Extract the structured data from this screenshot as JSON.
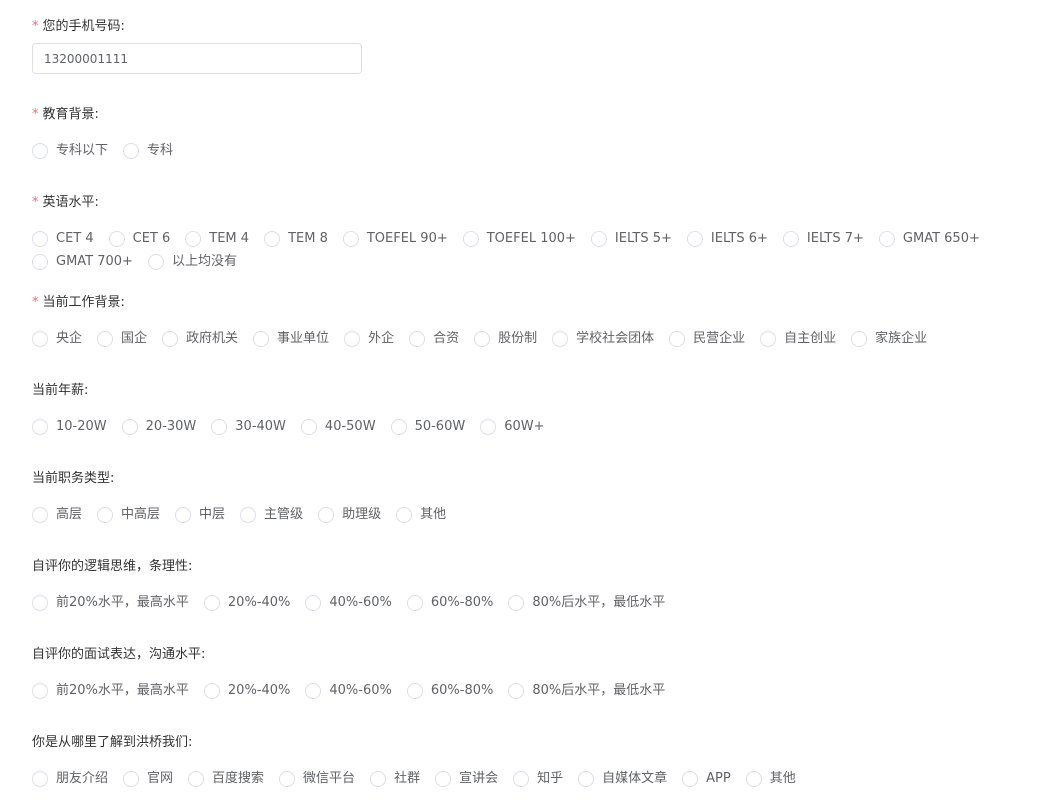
{
  "phone": {
    "label": "您的手机号码:",
    "required_mark": "*",
    "value": "13200001111"
  },
  "education": {
    "label": "教育背景:",
    "required_mark": "*",
    "options": [
      "专科以下",
      "专科"
    ]
  },
  "english": {
    "label": "英语水平:",
    "required_mark": "*",
    "options": [
      "CET 4",
      "CET 6",
      "TEM 4",
      "TEM 8",
      "TOEFEL 90+",
      "TOEFEL 100+",
      "IELTS 5+",
      "IELTS 6+",
      "IELTS 7+",
      "GMAT 650+",
      "GMAT 700+",
      "以上均没有"
    ]
  },
  "work": {
    "label": "当前工作背景:",
    "required_mark": "*",
    "options": [
      "央企",
      "国企",
      "政府机关",
      "事业单位",
      "外企",
      "合资",
      "股份制",
      "学校社会团体",
      "民营企业",
      "自主创业",
      "家族企业"
    ]
  },
  "salary": {
    "label": "当前年薪:",
    "options": [
      "10-20W",
      "20-30W",
      "30-40W",
      "40-50W",
      "50-60W",
      "60W+"
    ]
  },
  "position": {
    "label": "当前职务类型:",
    "options": [
      "高层",
      "中高层",
      "中层",
      "主管级",
      "助理级",
      "其他"
    ]
  },
  "logic": {
    "label": "自评你的逻辑思维，条理性:",
    "options": [
      "前20%水平，最高水平",
      "20%-40%",
      "40%-60%",
      "60%-80%",
      "80%后水平，最低水平"
    ]
  },
  "interview": {
    "label": "自评你的面试表达，沟通水平:",
    "options": [
      "前20%水平，最高水平",
      "20%-40%",
      "40%-60%",
      "60%-80%",
      "80%后水平，最低水平"
    ]
  },
  "source": {
    "label": "你是从哪里了解到洪桥我们:",
    "options": [
      "朋友介绍",
      "官网",
      "百度搜索",
      "微信平台",
      "社群",
      "宣讲会",
      "知乎",
      "自媒体文章",
      "APP",
      "其他"
    ]
  }
}
